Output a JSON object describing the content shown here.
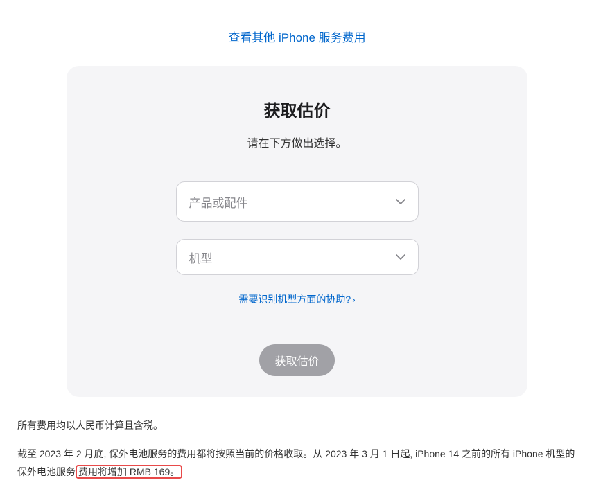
{
  "top_link": {
    "label": "查看其他 iPhone 服务费用"
  },
  "card": {
    "title": "获取估价",
    "subtitle": "请在下方做出选择。",
    "select1": {
      "placeholder": "产品或配件"
    },
    "select2": {
      "placeholder": "机型"
    },
    "help_link": {
      "label": "需要识别机型方面的协助?"
    },
    "submit_button": {
      "label": "获取估价"
    }
  },
  "footer": {
    "line1": "所有费用均以人民币计算且含税。",
    "line2_part1": "截至 2023 年 2 月底, 保外电池服务的费用都将按照当前的价格收取。从 2023 年 3 月 1 日起, iPhone 14 之前的所有 iPhone 机型的保外电池服务",
    "line2_highlight": "费用将增加 RMB 169。"
  }
}
